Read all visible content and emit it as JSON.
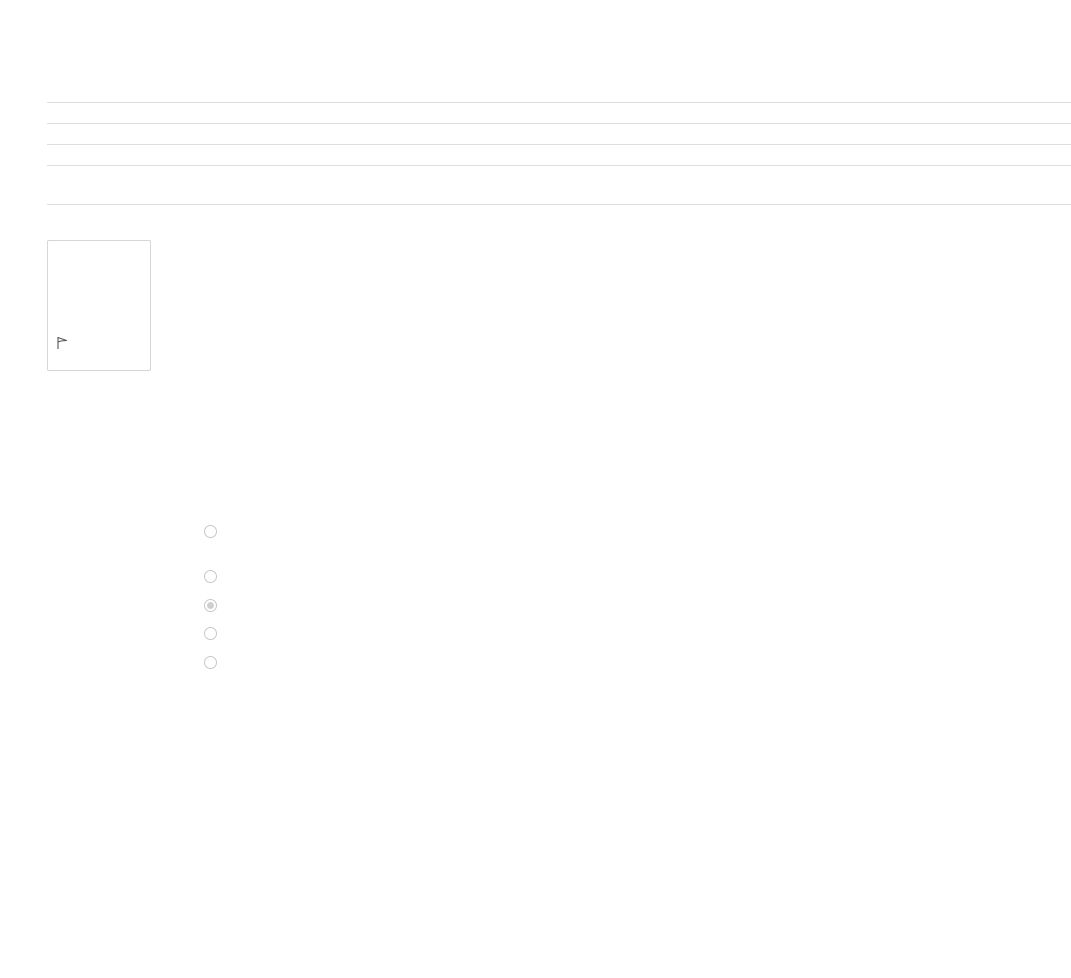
{
  "list": {
    "rows": [
      "",
      "",
      "",
      ""
    ]
  },
  "card": {
    "icon": "flag-icon"
  },
  "options": {
    "items": [
      {
        "label": "",
        "checked": false
      },
      {
        "label": "",
        "checked": false
      },
      {
        "label": "",
        "checked": true
      },
      {
        "label": "",
        "checked": false
      },
      {
        "label": "",
        "checked": false
      }
    ]
  },
  "colors": {
    "divider": "#dedede",
    "card_border": "#d6d6d6",
    "radio_border": "#c8c8c8",
    "radio_checked_dot": "#cfcfcf",
    "icon_stroke": "#555555"
  }
}
